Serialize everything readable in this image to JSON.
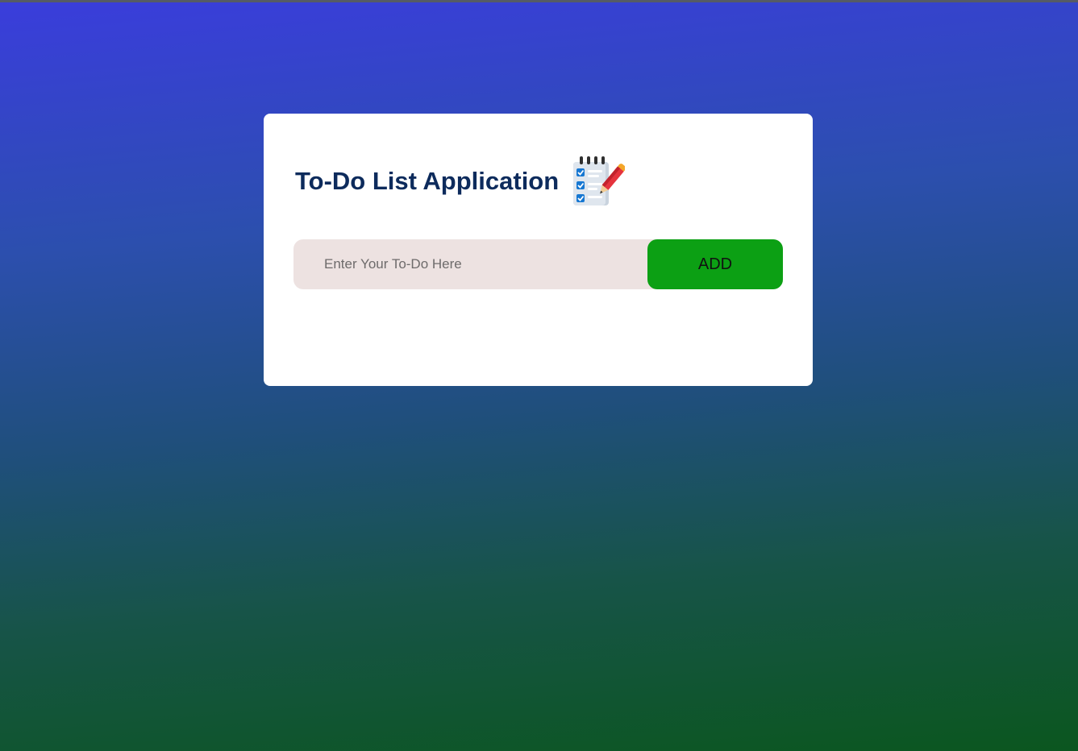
{
  "app": {
    "title": "To-Do List Application",
    "icon": "notepad-checklist-pencil-icon"
  },
  "todo_input": {
    "value": "",
    "placeholder": "Enter Your To-Do Here"
  },
  "add_button": {
    "label": "ADD"
  },
  "colors": {
    "title": "#0d2b5c",
    "button": "#0ca014",
    "input_background": "#ede2e1",
    "gradient_top": "#3a3ddc",
    "gradient_bottom": "#0b561f"
  }
}
